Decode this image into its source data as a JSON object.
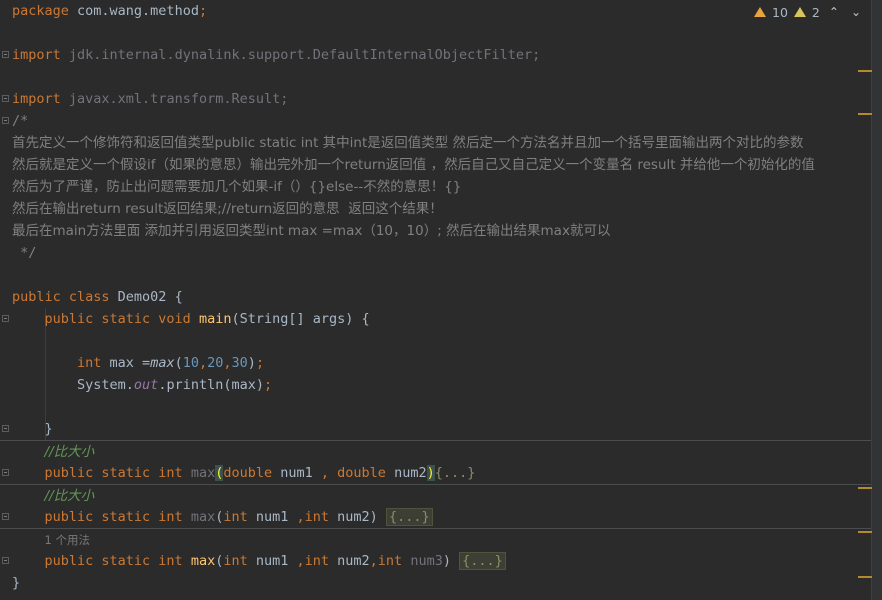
{
  "editor": {
    "lines": [
      {
        "fold": false,
        "segs": [
          {
            "c": "kw",
            "t": "package "
          },
          {
            "c": "",
            "t": "com.wang.method"
          },
          {
            "c": "kw",
            "t": ";"
          }
        ]
      },
      {
        "fold": false,
        "segs": []
      },
      {
        "fold": true,
        "segs": [
          {
            "c": "kw",
            "t": "import "
          },
          {
            "c": "unused",
            "t": "jdk.internal.dynalink.support.DefaultInternalObjectFilter;"
          }
        ]
      },
      {
        "fold": false,
        "segs": []
      },
      {
        "fold": true,
        "segs": [
          {
            "c": "kw",
            "t": "import "
          },
          {
            "c": "unused",
            "t": "javax.xml.transform.Result;"
          }
        ]
      },
      {
        "fold": true,
        "segs": [
          {
            "c": "cmt",
            "t": "/*"
          }
        ]
      },
      {
        "fold": false,
        "segs": [
          {
            "c": "cmt",
            "t": "首先定义一个修饰符和返回值类型public static int 其中int是返回值类型 然后定一个方法名并且加一个括号里面输出两个对比的参数"
          }
        ]
      },
      {
        "fold": false,
        "segs": [
          {
            "c": "cmt",
            "t": "然后就是定义一个假设if（如果的意思）输出完外加一个return返回值 ，然后自己又自己定义一个变量名 result 并给他一个初始化的值"
          }
        ]
      },
      {
        "fold": false,
        "segs": [
          {
            "c": "cmt",
            "t": "然后为了严谨，防止出问题需要加几个如果-if（）{}else--不然的意思！{}"
          }
        ]
      },
      {
        "fold": false,
        "segs": [
          {
            "c": "cmt",
            "t": "然后在输出return result返回结果;//return返回的意思  返回这个结果！"
          }
        ]
      },
      {
        "fold": false,
        "segs": [
          {
            "c": "cmt",
            "t": "最后在main方法里面 添加并引用返回类型int max =max（10，10）; 然后在输出结果max就可以"
          }
        ]
      },
      {
        "fold": false,
        "segs": [
          {
            "c": "cmt",
            "t": " */"
          }
        ]
      },
      {
        "fold": false,
        "segs": []
      },
      {
        "fold": false,
        "segs": [
          {
            "c": "kw",
            "t": "public class "
          },
          {
            "c": "",
            "t": "Demo02 {"
          }
        ]
      },
      {
        "fold": true,
        "segs": [
          {
            "c": "",
            "t": "    "
          },
          {
            "c": "kw",
            "t": "public static void "
          },
          {
            "c": "fn",
            "t": "main"
          },
          {
            "c": "",
            "t": "(String[] args) {"
          }
        ]
      },
      {
        "fold": false,
        "segs": []
      },
      {
        "fold": false,
        "segs": [
          {
            "c": "",
            "t": "        "
          },
          {
            "c": "kw",
            "t": "int "
          },
          {
            "c": "",
            "t": "max ="
          },
          {
            "c": "sm",
            "t": "max"
          },
          {
            "c": "",
            "t": "("
          },
          {
            "c": "num",
            "t": "10"
          },
          {
            "c": "kw",
            "t": ","
          },
          {
            "c": "num",
            "t": "20"
          },
          {
            "c": "kw",
            "t": ","
          },
          {
            "c": "num",
            "t": "30"
          },
          {
            "c": "",
            "t": ")"
          },
          {
            "c": "kw",
            "t": ";"
          }
        ]
      },
      {
        "fold": false,
        "segs": [
          {
            "c": "",
            "t": "        System."
          },
          {
            "c": "sfld",
            "t": "out"
          },
          {
            "c": "",
            "t": ".println(max)"
          },
          {
            "c": "kw",
            "t": ";"
          }
        ]
      },
      {
        "fold": false,
        "segs": []
      },
      {
        "fold": true,
        "segs": [
          {
            "c": "",
            "t": "    }"
          }
        ]
      },
      {
        "fold": false,
        "sep": true,
        "segs": [
          {
            "c": "",
            "t": "    "
          },
          {
            "c": "doc",
            "t": "//比大小"
          }
        ]
      },
      {
        "fold": true,
        "segs": [
          {
            "c": "",
            "t": "    "
          },
          {
            "c": "kw",
            "t": "public static int "
          },
          {
            "c": "unused",
            "t": "max"
          },
          {
            "c": "brmatch",
            "t": "("
          },
          {
            "c": "kw",
            "t": "double "
          },
          {
            "c": "",
            "t": "num1 "
          },
          {
            "c": "kw",
            "t": ", double "
          },
          {
            "c": "",
            "t": "num2"
          },
          {
            "c": "brmatch",
            "t": ")"
          },
          {
            "c": "folded-plain",
            "t": "{...}"
          }
        ]
      },
      {
        "fold": false,
        "sep": true,
        "segs": [
          {
            "c": "",
            "t": "    "
          },
          {
            "c": "doc",
            "t": "//比大小"
          }
        ]
      },
      {
        "fold": true,
        "segs": [
          {
            "c": "",
            "t": "    "
          },
          {
            "c": "kw",
            "t": "public static int "
          },
          {
            "c": "unused",
            "t": "max"
          },
          {
            "c": "",
            "t": "("
          },
          {
            "c": "kw",
            "t": "int "
          },
          {
            "c": "",
            "t": "num1 "
          },
          {
            "c": "kw",
            "t": ",int "
          },
          {
            "c": "",
            "t": "num2) "
          },
          {
            "c": "folded",
            "t": "{...}"
          }
        ]
      },
      {
        "fold": false,
        "sep": true,
        "segs": [
          {
            "c": "",
            "t": "    "
          },
          {
            "c": "hint",
            "t": "1 个用法"
          }
        ]
      },
      {
        "fold": true,
        "segs": [
          {
            "c": "",
            "t": "    "
          },
          {
            "c": "kw",
            "t": "public static int "
          },
          {
            "c": "fn",
            "t": "max"
          },
          {
            "c": "",
            "t": "("
          },
          {
            "c": "kw",
            "t": "int "
          },
          {
            "c": "",
            "t": "num1 "
          },
          {
            "c": "kw",
            "t": ",int "
          },
          {
            "c": "",
            "t": "num2"
          },
          {
            "c": "kw",
            "t": ",int "
          },
          {
            "c": "unused",
            "t": "num3"
          },
          {
            "c": "",
            "t": ") "
          },
          {
            "c": "folded",
            "t": "{...}"
          }
        ]
      },
      {
        "fold": false,
        "segs": [
          {
            "c": "",
            "t": "}"
          }
        ]
      }
    ]
  },
  "inspections": {
    "warnings": "10",
    "weak_warnings": "2",
    "up_label": "^",
    "down_label": "v"
  },
  "colors": {
    "background": "#2b2b2b",
    "keyword": "#cc7832",
    "comment": "#808080",
    "number": "#6897bb",
    "function": "#ffc66d",
    "warning": "#e8a33d"
  }
}
